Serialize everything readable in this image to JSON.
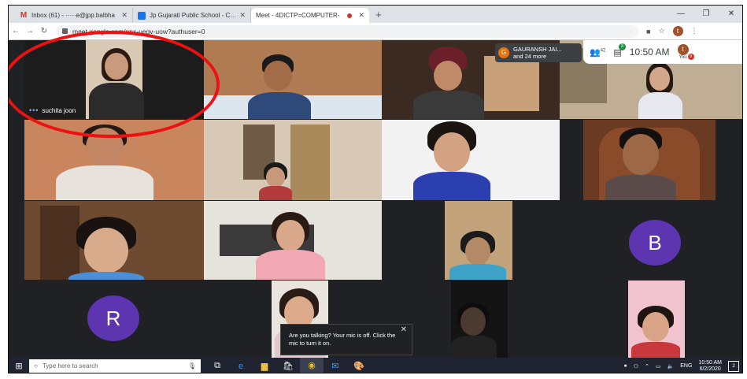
{
  "browser": {
    "tabs": [
      {
        "title": "Inbox (61) - ·····e@jpp.balbha",
        "icon": "gmail-icon"
      },
      {
        "title": "Jp Gujarati Public School - Calen",
        "icon": "calendar-icon"
      },
      {
        "title": "Meet - 4DICTP=COMPUTER-",
        "icon": "meet-icon"
      }
    ],
    "new_tab": "+",
    "url": "meet.google.com/nnx-ueqv-uow?authuser=0",
    "profile_initial": "t"
  },
  "meet": {
    "presenter_name": "GAURANSH JAI...",
    "presenter_sub": "and 24 more",
    "presenter_initial": "G",
    "participants_count": "42",
    "chat_badge": "3",
    "time": "10:50 AM",
    "you_label": "You",
    "you_initial": "t",
    "you_badge": "9",
    "tile_name": "suchita joon",
    "tile_dots": "•••",
    "avatar_b": "B",
    "avatar_r": "R",
    "toast_text": "Are you talking? Your mic is off. Click the mic to turn it on."
  },
  "taskbar": {
    "search_placeholder": "Type here to search",
    "lang": "ENG",
    "time": "10:50 AM",
    "date": "6/2/2020",
    "notif_count": "2"
  },
  "colors": {
    "avatar": "#5e35b1",
    "ring": "#e11111",
    "meet_bg": "#202124"
  }
}
